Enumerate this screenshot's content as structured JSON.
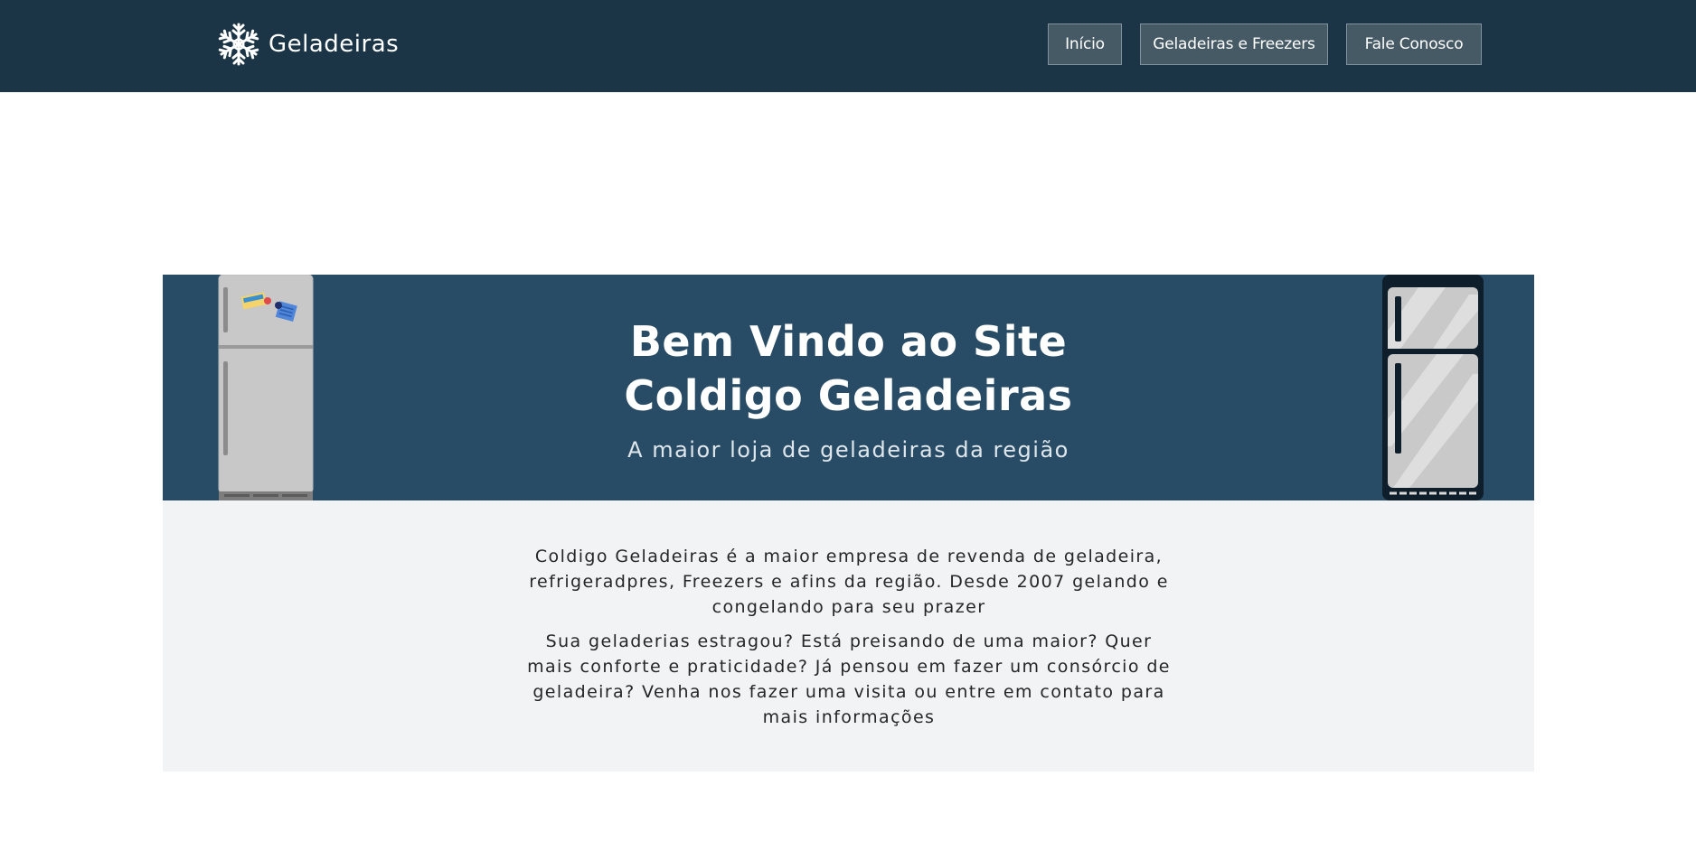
{
  "header": {
    "logo_text": "Geladeiras",
    "logo_icon": "snowflake-icon",
    "nav": [
      {
        "label": "Início"
      },
      {
        "label": "Geladeiras e Freezers"
      },
      {
        "label": "Fale Conosco"
      }
    ]
  },
  "hero": {
    "title_line1": "Bem Vindo ao Site",
    "title_line2": "Coldigo Geladeiras",
    "subtitle": "A maior loja de geladeiras da região"
  },
  "about": {
    "paragraph1": "Coldigo Geladeiras é a maior empresa de revenda de geladeira, refrigeradpres, Freezers e afins da região. Desde 2007 gelando e congelando para seu prazer",
    "paragraph2": "Sua geladerias estragou? Está preisando de uma maior? Quer mais conforte e praticidade? Já pensou em fazer um consórcio de geladeira? Venha nos fazer uma visita ou entre em contato para mais informações"
  },
  "colors": {
    "header_bg": "#1b3547",
    "hero_bg": "#294c66",
    "nav_button_bg": "#465a66",
    "content_bg": "#f2f3f5"
  }
}
